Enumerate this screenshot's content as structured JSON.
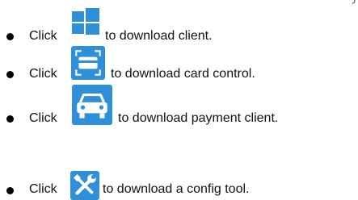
{
  "items": [
    {
      "verb": "Click",
      "icon": "windows-icon",
      "rest": "to download client."
    },
    {
      "verb": "Click",
      "icon": "card-icon",
      "rest": "to download card control."
    },
    {
      "verb": "Click",
      "icon": "car-icon",
      "rest": "to download payment client."
    },
    {
      "verb": "Click",
      "icon": "tools-icon",
      "rest": "to download a config tool."
    }
  ],
  "colors": {
    "icon_blue": "#2f8fd8",
    "text": "#111111"
  }
}
